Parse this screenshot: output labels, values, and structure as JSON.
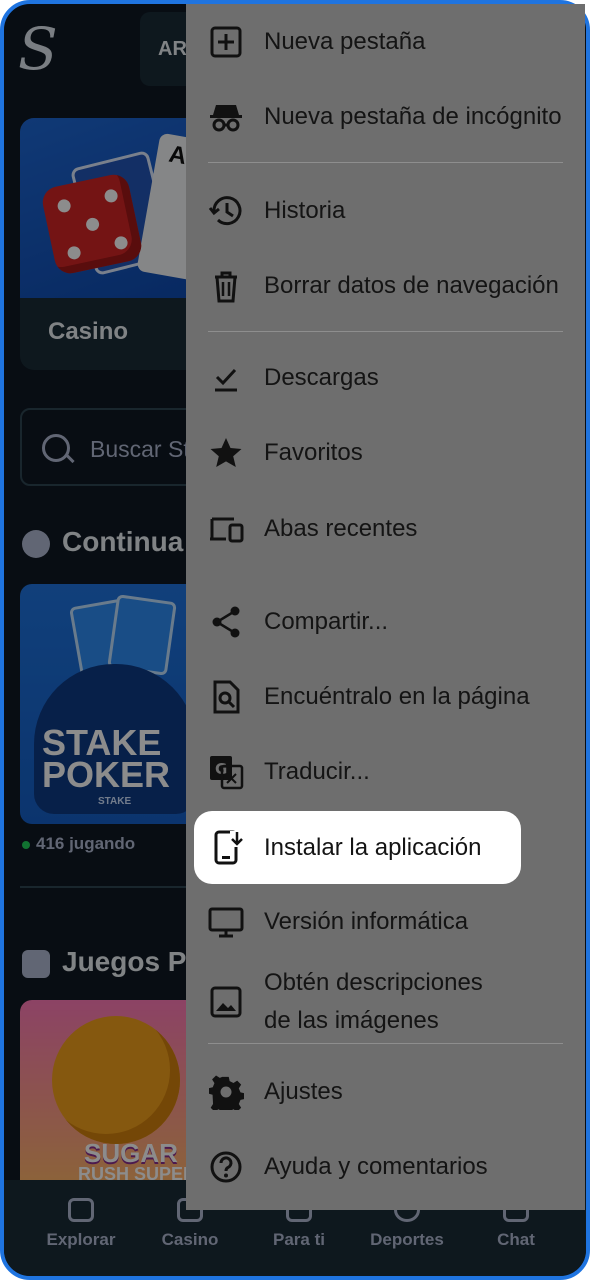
{
  "app": {
    "header_button_label": "AR",
    "casino_card_label": "Casino",
    "search_placeholder": "Buscar St",
    "continue_section_title": "Continua",
    "poker_game": {
      "line1": "STAKE",
      "line2": "POKER",
      "brand": "STAKE"
    },
    "poker_players": "416 jugando",
    "popular_section_title": "Juegos Po",
    "sugar_game": {
      "line1": "SUGAR",
      "line2": "RUSH SUPER"
    },
    "bottom_nav": [
      {
        "label": "Explorar",
        "icon": "search-list-icon"
      },
      {
        "label": "Casino",
        "icon": "cards-icon"
      },
      {
        "label": "Para ti",
        "icon": "sparkle-card-icon"
      },
      {
        "label": "Deportes",
        "icon": "ball-icon"
      },
      {
        "label": "Chat",
        "icon": "chat-icon"
      }
    ]
  },
  "menu": {
    "items": [
      {
        "label": "Nueva pestaña",
        "icon": "plus-box-icon"
      },
      {
        "label": "Nueva pestaña de incógnito",
        "icon": "incognito-icon"
      },
      {
        "label": "Historia",
        "icon": "history-icon"
      },
      {
        "label": "Borrar datos de navegación",
        "icon": "trash-icon"
      },
      {
        "label": "Descargas",
        "icon": "download-icon"
      },
      {
        "label": "Favoritos",
        "icon": "star-icon"
      },
      {
        "label": "Abas recentes",
        "icon": "devices-icon"
      },
      {
        "label": "Compartir...",
        "icon": "share-icon"
      },
      {
        "label": "Encuéntralo en la página",
        "icon": "find-in-page-icon"
      },
      {
        "label": "Traducir...",
        "icon": "translate-icon"
      },
      {
        "label": "Instalar la aplicación",
        "icon": "install-app-icon"
      },
      {
        "label": "Versión informática",
        "icon": "desktop-icon"
      },
      {
        "label": "Obtén descripciones\nde las imágenes",
        "icon": "image-icon"
      },
      {
        "label": "Ajustes",
        "icon": "settings-icon"
      },
      {
        "label": "Ayuda y comentarios",
        "icon": "help-icon"
      }
    ],
    "highlighted_index": 10
  },
  "colors": {
    "frame": "#1f74e0",
    "menu_bg": "#6e6e6e",
    "app_bg": "#0f1923"
  }
}
